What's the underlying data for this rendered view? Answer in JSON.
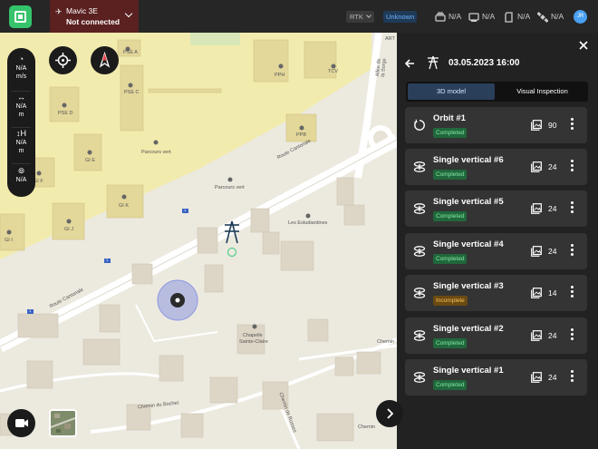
{
  "drone": {
    "name": "Mavic 3E",
    "status": "Not connected"
  },
  "topbar": {
    "rtk_label": "RTK",
    "rtk_status": "Unknown",
    "stat1": "N/A",
    "stat2": "N/A",
    "stat3": "N/A",
    "stat4": "N/A",
    "avatar": "JR"
  },
  "telemetry": {
    "speed_value": "N/A",
    "speed_unit": "m/s",
    "distance_value": "N/A",
    "distance_unit": "m",
    "height_value": "N/A",
    "height_unit": "m",
    "gps_value": "N/A"
  },
  "map_labels": {
    "pse_a": "PSE A",
    "pph": "PPH",
    "tcv": "TCV",
    "pse_c": "PSE C",
    "pse_d": "PSE D",
    "ppb": "PPB",
    "parcours_vert_1": "Parcours vert",
    "gi_e": "GI E",
    "route_cantonale_1": "Route Cantonale",
    "parcours_vert_2": "Parcours vert",
    "gi_f": "GI F",
    "gi_k": "GI K",
    "gi_i": "GI I",
    "gi_j": "GI J",
    "les_estudiantines": "Les Estudiantines",
    "route_cantonale_2": "Route Cantonale",
    "chapelle": "Chapelle",
    "sainte_claire": "Sainte-Claire",
    "allee_sorge": "Allée de la Sorge",
    "chemin_bochet": "Chemin du Bochet",
    "chemin_rosses": "Chemin de Rosses",
    "art": "ART",
    "chemin": "Chemin",
    "chemin_2": "Chemin",
    "shield_1": "1",
    "shield_2": "1",
    "shield_3": "1"
  },
  "panel": {
    "title": "03.05.2023 16:00",
    "tab_3d": "3D model",
    "tab_visual": "Visual Inspection"
  },
  "flights": [
    {
      "name": "Orbit #1",
      "status": "Completed",
      "count": "90",
      "icon": "orbit-icon"
    },
    {
      "name": "Single vertical #6",
      "status": "Completed",
      "count": "24",
      "icon": "vertical-icon"
    },
    {
      "name": "Single vertical #5",
      "status": "Completed",
      "count": "24",
      "icon": "vertical-icon"
    },
    {
      "name": "Single vertical #4",
      "status": "Completed",
      "count": "24",
      "icon": "vertical-icon"
    },
    {
      "name": "Single vertical #3",
      "status": "Incomplete",
      "count": "14",
      "icon": "vertical-icon"
    },
    {
      "name": "Single vertical #2",
      "status": "Completed",
      "count": "24",
      "icon": "vertical-icon"
    },
    {
      "name": "Single vertical #1",
      "status": "Completed",
      "count": "24",
      "icon": "vertical-icon"
    }
  ],
  "colors": {
    "accent": "#35c36b",
    "completed": "#86e6a6",
    "incomplete": "#f7c25a",
    "map_yellow": "#f2ebae"
  }
}
